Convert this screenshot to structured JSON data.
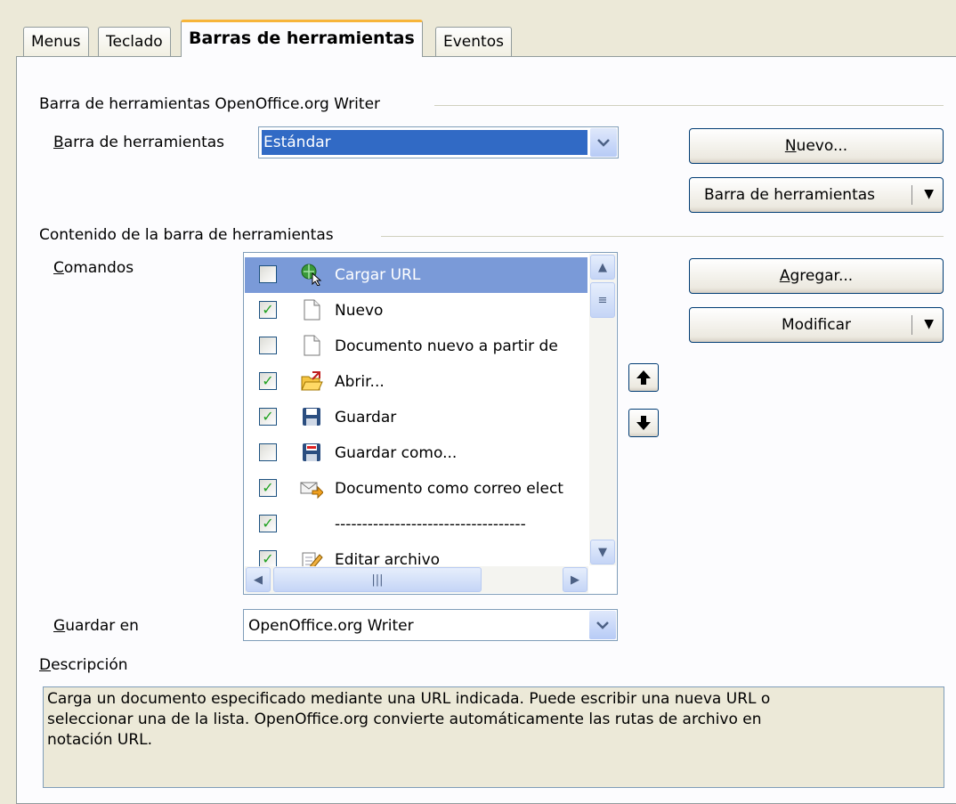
{
  "tabs": [
    "Menus",
    "Teclado",
    "Barras de herramientas",
    "Eventos"
  ],
  "toolbar_group": {
    "title": "Barra de herramientas OpenOffice.org Writer",
    "label_mnemonic": "B",
    "label_rest": "arra de herramientas",
    "selected": "Estándar"
  },
  "buttons": {
    "nuevo_mnemonic": "N",
    "nuevo_rest": "uevo...",
    "toolbar_menu": "Barra de herramientas",
    "agregar_pre": "",
    "agregar_mnemonic": "A",
    "agregar_rest": "gregar...",
    "modificar": "Modificar"
  },
  "content_group": {
    "title": "Contenido de la barra de herramientas",
    "commands_mnemonic": "C",
    "commands_rest": "omandos"
  },
  "commands": [
    {
      "checked": false,
      "icon": "load-url-icon",
      "label": "Cargar URL",
      "selected": true
    },
    {
      "checked": true,
      "icon": "new-document-icon",
      "label": "Nuevo",
      "selected": false
    },
    {
      "checked": false,
      "icon": "new-document-icon",
      "label": "Documento nuevo a partir de",
      "selected": false
    },
    {
      "checked": true,
      "icon": "open-folder-icon",
      "label": "Abrir...",
      "selected": false
    },
    {
      "checked": true,
      "icon": "save-icon",
      "label": "Guardar",
      "selected": false
    },
    {
      "checked": false,
      "icon": "save-as-icon",
      "label": "Guardar como...",
      "selected": false
    },
    {
      "checked": true,
      "icon": "email-document-icon",
      "label": "Documento como correo elect",
      "selected": false
    },
    {
      "checked": true,
      "icon": "",
      "label": "-----------------------------------",
      "selected": false
    },
    {
      "checked": true,
      "icon": "edit-file-icon",
      "label": "Editar archivo",
      "selected": false
    }
  ],
  "save_in": {
    "label_mnemonic": "G",
    "label_rest": "uardar en",
    "value": "OpenOffice.org Writer"
  },
  "description": {
    "label_mnemonic": "D",
    "label_rest": "escripción",
    "lines": [
      "Carga un documento especificado mediante una URL indicada. Puede escribir una nueva URL o",
      "seleccionar una de la lista. OpenOffice.org convierte automáticamente las rutas de archivo en",
      "notación URL."
    ]
  },
  "colors": {
    "selection": "#7a9ad8",
    "tab_highlight": "#f7b53a",
    "check": "#21a121"
  }
}
